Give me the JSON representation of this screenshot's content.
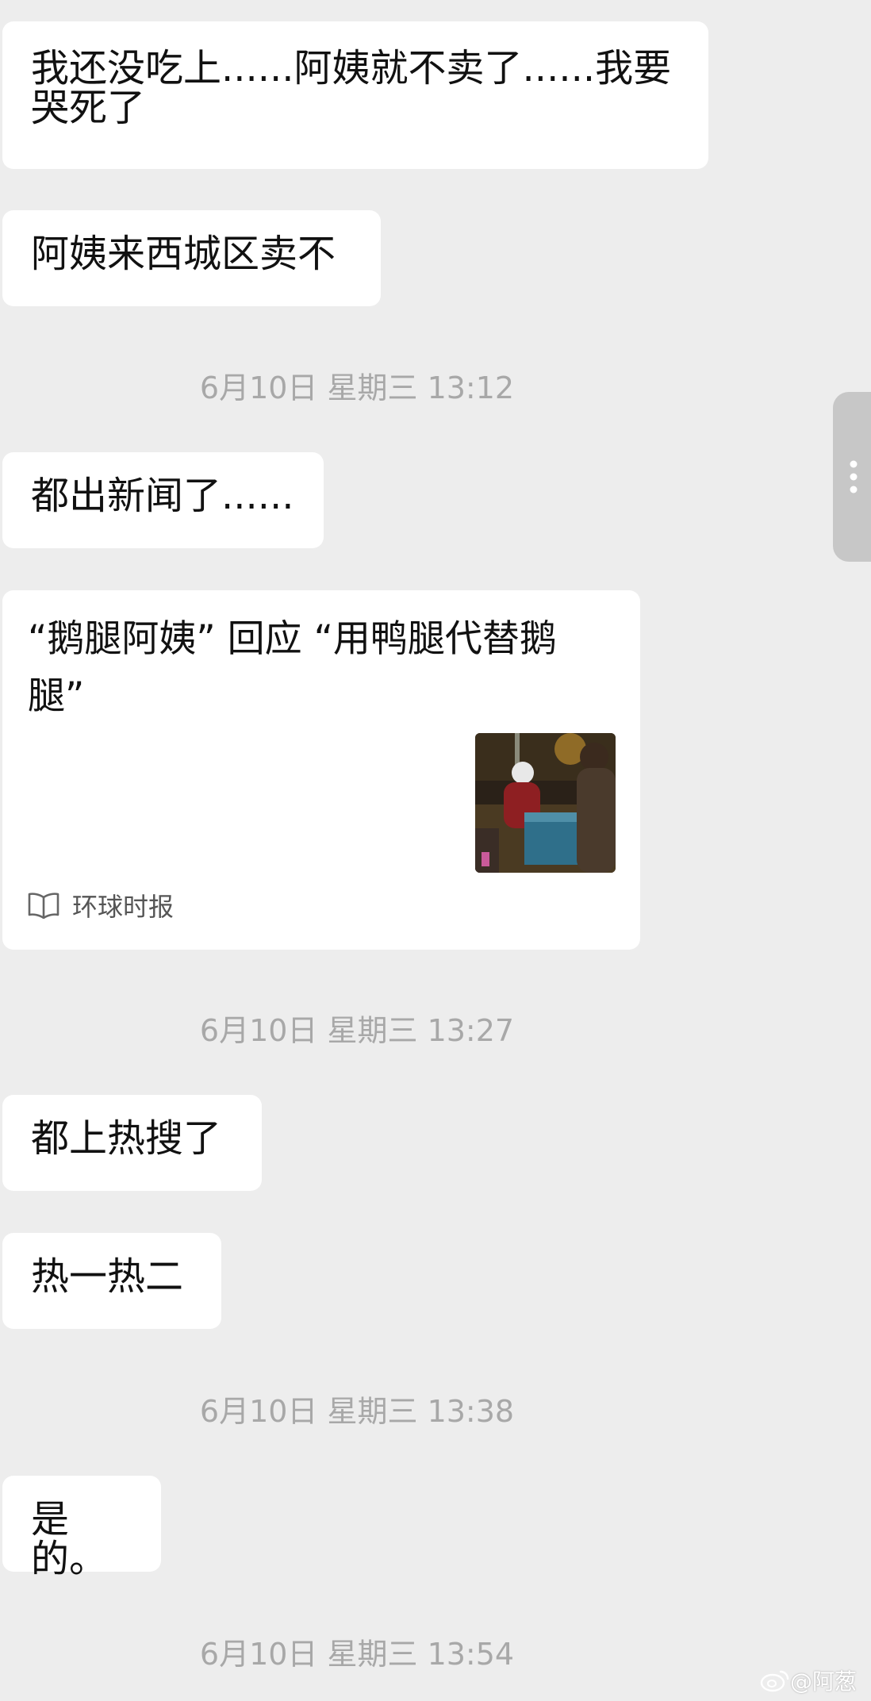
{
  "messages": [
    {
      "text": "我还没吃上......阿姨就不卖了......我要哭死了"
    },
    {
      "text": "阿姨来西城区卖不"
    },
    {
      "timestamp": "6月10日 星期三 13:12"
    },
    {
      "text": "都出新闻了......"
    },
    {
      "card": {
        "title": "“鹅腿阿姨” 回应 “用鸭腿代替鹅腿”",
        "source": "环球时报",
        "source_icon": "open-book-icon",
        "thumbnail": "night-street-photo"
      }
    },
    {
      "timestamp": "6月10日 星期三 13:27"
    },
    {
      "text": "都上热搜了"
    },
    {
      "text": "热一热二"
    },
    {
      "timestamp": "6月10日 星期三 13:38"
    },
    {
      "text": "是的。"
    },
    {
      "timestamp": "6月10日 星期三 13:54"
    }
  ],
  "side_handle": {
    "icon": "vertical-dots-icon"
  },
  "watermark": {
    "text": "@阿葱",
    "icon": "weibo-icon"
  },
  "colors": {
    "background": "#ededed",
    "bubble": "#ffffff",
    "timestamp": "#a8a8a8"
  }
}
